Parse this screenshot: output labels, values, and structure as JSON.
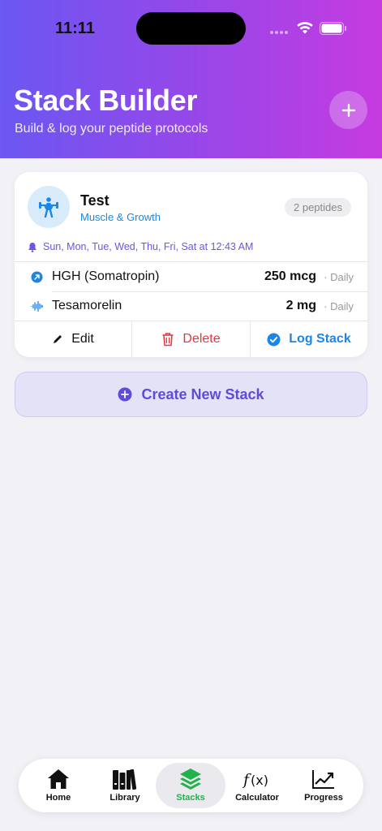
{
  "status_bar": {
    "time": "11:11"
  },
  "header": {
    "title": "Stack Builder",
    "subtitle": "Build & log your peptide protocols"
  },
  "stack_card": {
    "name": "Test",
    "category": "Muscle & Growth",
    "count_badge": "2 peptides",
    "schedule": "Sun, Mon, Tue, Wed, Thu, Fri, Sat at 12:43 AM",
    "peptides": [
      {
        "name": "HGH (Somatropin)",
        "dose": "250 mcg",
        "frequency": "· Daily",
        "icon": "arrow-up-right-circle-icon"
      },
      {
        "name": "Tesamorelin",
        "dose": "2 mg",
        "frequency": "· Daily",
        "icon": "waveform-icon"
      }
    ],
    "actions": {
      "edit": "Edit",
      "delete": "Delete",
      "log": "Log Stack"
    }
  },
  "create_button": {
    "label": "Create New Stack"
  },
  "tabbar": {
    "tabs": [
      {
        "label": "Home",
        "icon": "house-icon"
      },
      {
        "label": "Library",
        "icon": "books-icon"
      },
      {
        "label": "Stacks",
        "icon": "layers-icon"
      },
      {
        "label": "Calculator",
        "icon": "function-icon"
      },
      {
        "label": "Progress",
        "icon": "chart-line-icon"
      }
    ],
    "active_tab": "Stacks"
  },
  "colors": {
    "header_gradient_start": "#6b57f2",
    "header_gradient_end": "#c63be0",
    "accent_purple": "#5d4cdc",
    "accent_blue": "#1c86e6",
    "delete_red": "#e0363c",
    "active_green": "#22b24c"
  }
}
